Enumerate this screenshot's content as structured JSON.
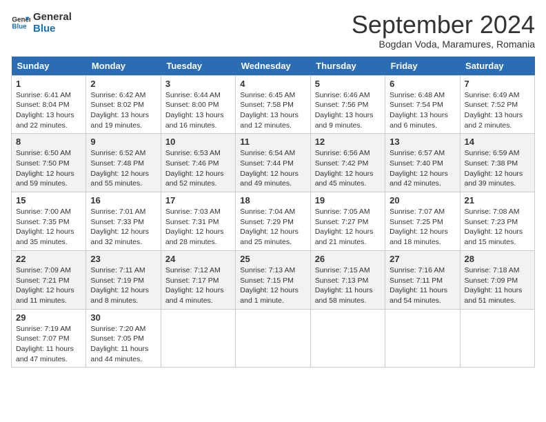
{
  "header": {
    "logo_line1": "General",
    "logo_line2": "Blue",
    "title": "September 2024",
    "subtitle": "Bogdan Voda, Maramures, Romania"
  },
  "weekdays": [
    "Sunday",
    "Monday",
    "Tuesday",
    "Wednesday",
    "Thursday",
    "Friday",
    "Saturday"
  ],
  "weeks": [
    [
      {
        "day": "1",
        "info": "Sunrise: 6:41 AM\nSunset: 8:04 PM\nDaylight: 13 hours\nand 22 minutes."
      },
      {
        "day": "2",
        "info": "Sunrise: 6:42 AM\nSunset: 8:02 PM\nDaylight: 13 hours\nand 19 minutes."
      },
      {
        "day": "3",
        "info": "Sunrise: 6:44 AM\nSunset: 8:00 PM\nDaylight: 13 hours\nand 16 minutes."
      },
      {
        "day": "4",
        "info": "Sunrise: 6:45 AM\nSunset: 7:58 PM\nDaylight: 13 hours\nand 12 minutes."
      },
      {
        "day": "5",
        "info": "Sunrise: 6:46 AM\nSunset: 7:56 PM\nDaylight: 13 hours\nand 9 minutes."
      },
      {
        "day": "6",
        "info": "Sunrise: 6:48 AM\nSunset: 7:54 PM\nDaylight: 13 hours\nand 6 minutes."
      },
      {
        "day": "7",
        "info": "Sunrise: 6:49 AM\nSunset: 7:52 PM\nDaylight: 13 hours\nand 2 minutes."
      }
    ],
    [
      {
        "day": "8",
        "info": "Sunrise: 6:50 AM\nSunset: 7:50 PM\nDaylight: 12 hours\nand 59 minutes."
      },
      {
        "day": "9",
        "info": "Sunrise: 6:52 AM\nSunset: 7:48 PM\nDaylight: 12 hours\nand 55 minutes."
      },
      {
        "day": "10",
        "info": "Sunrise: 6:53 AM\nSunset: 7:46 PM\nDaylight: 12 hours\nand 52 minutes."
      },
      {
        "day": "11",
        "info": "Sunrise: 6:54 AM\nSunset: 7:44 PM\nDaylight: 12 hours\nand 49 minutes."
      },
      {
        "day": "12",
        "info": "Sunrise: 6:56 AM\nSunset: 7:42 PM\nDaylight: 12 hours\nand 45 minutes."
      },
      {
        "day": "13",
        "info": "Sunrise: 6:57 AM\nSunset: 7:40 PM\nDaylight: 12 hours\nand 42 minutes."
      },
      {
        "day": "14",
        "info": "Sunrise: 6:59 AM\nSunset: 7:38 PM\nDaylight: 12 hours\nand 39 minutes."
      }
    ],
    [
      {
        "day": "15",
        "info": "Sunrise: 7:00 AM\nSunset: 7:35 PM\nDaylight: 12 hours\nand 35 minutes."
      },
      {
        "day": "16",
        "info": "Sunrise: 7:01 AM\nSunset: 7:33 PM\nDaylight: 12 hours\nand 32 minutes."
      },
      {
        "day": "17",
        "info": "Sunrise: 7:03 AM\nSunset: 7:31 PM\nDaylight: 12 hours\nand 28 minutes."
      },
      {
        "day": "18",
        "info": "Sunrise: 7:04 AM\nSunset: 7:29 PM\nDaylight: 12 hours\nand 25 minutes."
      },
      {
        "day": "19",
        "info": "Sunrise: 7:05 AM\nSunset: 7:27 PM\nDaylight: 12 hours\nand 21 minutes."
      },
      {
        "day": "20",
        "info": "Sunrise: 7:07 AM\nSunset: 7:25 PM\nDaylight: 12 hours\nand 18 minutes."
      },
      {
        "day": "21",
        "info": "Sunrise: 7:08 AM\nSunset: 7:23 PM\nDaylight: 12 hours\nand 15 minutes."
      }
    ],
    [
      {
        "day": "22",
        "info": "Sunrise: 7:09 AM\nSunset: 7:21 PM\nDaylight: 12 hours\nand 11 minutes."
      },
      {
        "day": "23",
        "info": "Sunrise: 7:11 AM\nSunset: 7:19 PM\nDaylight: 12 hours\nand 8 minutes."
      },
      {
        "day": "24",
        "info": "Sunrise: 7:12 AM\nSunset: 7:17 PM\nDaylight: 12 hours\nand 4 minutes."
      },
      {
        "day": "25",
        "info": "Sunrise: 7:13 AM\nSunset: 7:15 PM\nDaylight: 12 hours\nand 1 minute."
      },
      {
        "day": "26",
        "info": "Sunrise: 7:15 AM\nSunset: 7:13 PM\nDaylight: 11 hours\nand 58 minutes."
      },
      {
        "day": "27",
        "info": "Sunrise: 7:16 AM\nSunset: 7:11 PM\nDaylight: 11 hours\nand 54 minutes."
      },
      {
        "day": "28",
        "info": "Sunrise: 7:18 AM\nSunset: 7:09 PM\nDaylight: 11 hours\nand 51 minutes."
      }
    ],
    [
      {
        "day": "29",
        "info": "Sunrise: 7:19 AM\nSunset: 7:07 PM\nDaylight: 11 hours\nand 47 minutes."
      },
      {
        "day": "30",
        "info": "Sunrise: 7:20 AM\nSunset: 7:05 PM\nDaylight: 11 hours\nand 44 minutes."
      },
      {
        "day": "",
        "info": ""
      },
      {
        "day": "",
        "info": ""
      },
      {
        "day": "",
        "info": ""
      },
      {
        "day": "",
        "info": ""
      },
      {
        "day": "",
        "info": ""
      }
    ]
  ]
}
